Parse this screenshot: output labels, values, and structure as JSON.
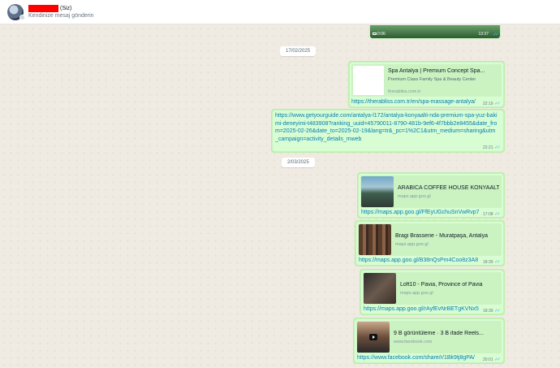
{
  "header": {
    "name_suffix": "(Siz)",
    "subtitle": "Kendinize mesaj gönderin"
  },
  "colors": {
    "outgoing_bubble": "#d9fdd3",
    "link": "#027eb5",
    "redaction": "#ff0000",
    "read_ticks": "#53bdeb"
  },
  "video_message": {
    "duration": "0:06",
    "time": "13:37"
  },
  "date_separators": [
    "17/02/2025",
    "2/03/2025"
  ],
  "messages": [
    {
      "preview_title": "Spa Antalya | Premium Concept Spa...",
      "preview_desc": "Premium Class Family Spa & Beauty Center",
      "preview_domain": "therabliss.com.tr",
      "link": "https://therabliss.com.tr/en/spa-massage-antalya/",
      "time": "22:19"
    },
    {
      "link": "https://www.getyourguide.com/antalya-l172/antalya-konyaalti-nda-premium-spa-yuz-bakimi-deneyimi-t483908?ranking_uuid=45790011-8790-481b-9ef6-4f7bbb2e8455&date_from=2025-02-26&date_to=2025-02-19&lang=tr&_pc=1%2C1&utm_medium=sharing&utm_campaign=activity_details_mweb",
      "time": "22:21"
    },
    {
      "preview_title": "ARABICA COFFEE HOUSE KONYAALTI...",
      "preview_domain": "maps.app.goo.gl",
      "link": "https://maps.app.goo.gl/FfEyUGchuSnVwRvp7",
      "time": "17:08",
      "image_icon": "cafe-photo"
    },
    {
      "preview_title": "Bragi Brasserie - Muratpaşa, Antalya",
      "preview_domain": "maps.app.goo.gl",
      "link": "https://maps.app.goo.gl/B38nQsPm4Coo8z3A8",
      "time": "18:39",
      "image_icon": "restaurant-photo"
    },
    {
      "preview_title": "Loft10 - Pavia, Province of Pavia",
      "preview_domain": "maps.app.goo.gl",
      "link": "https://maps.app.goo.gl/rAyfEvNrBETgKVNx5",
      "time": "18:39",
      "image_icon": "loft-photo"
    },
    {
      "preview_title": "9 B görüntüleme · 3 B ifade Reels...",
      "preview_domain": "www.facebook.com",
      "link": "https://www.facebook.com/share/r/1Bk9tj8gPA/",
      "time": "20:01",
      "image_icon": "video-thumbnail"
    }
  ]
}
